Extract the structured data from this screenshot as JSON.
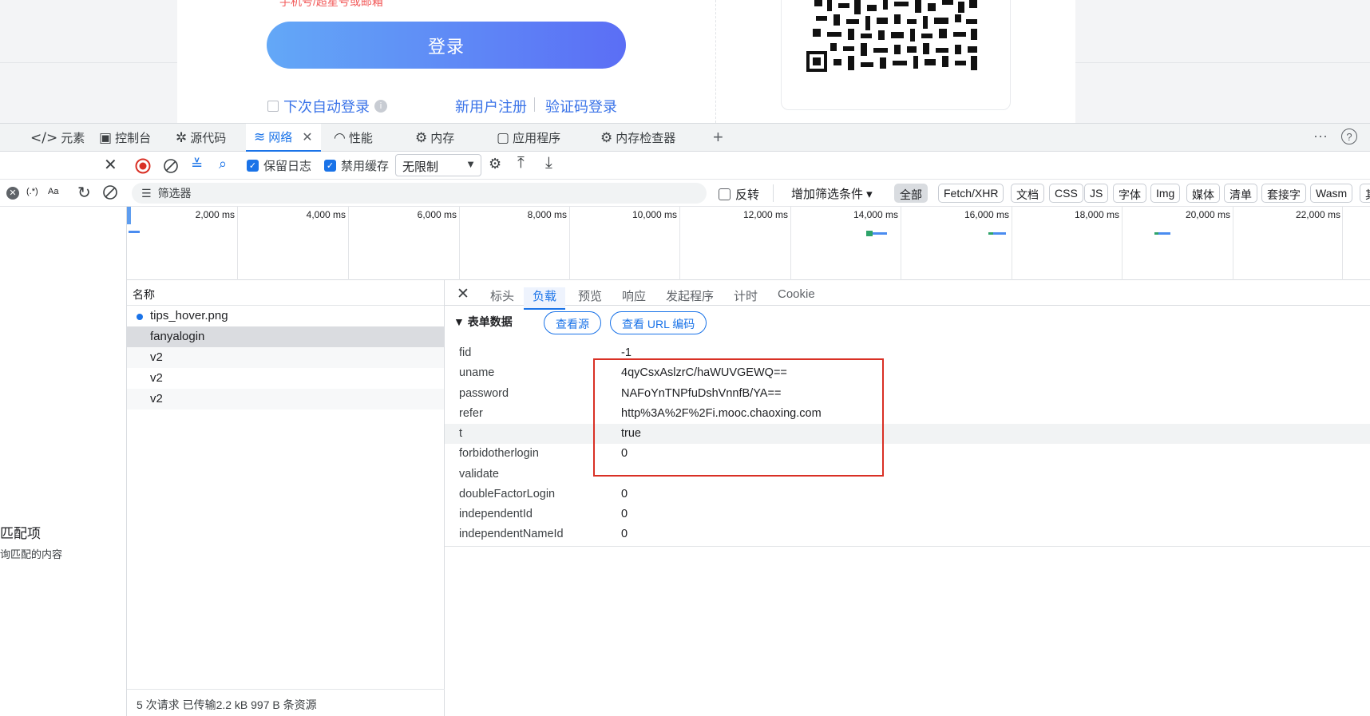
{
  "page": {
    "login_button": "登录",
    "cut_text": "手机号/超星号或邮箱",
    "auto_login": "下次自动登录",
    "register": "新用户注册",
    "code_login": "验证码登录"
  },
  "devtools": {
    "tabs": [
      {
        "icon": "</>",
        "label": "元素"
      },
      {
        "icon": "▣",
        "label": "控制台"
      },
      {
        "icon": "✲",
        "label": "源代码"
      },
      {
        "icon": "≋",
        "label": "网络"
      },
      {
        "icon": "◠",
        "label": "性能"
      },
      {
        "icon": "⚙",
        "label": "内存"
      },
      {
        "icon": "▢",
        "label": "应用程序"
      },
      {
        "icon": "⚙",
        "label": "内存检查器"
      }
    ],
    "add_tab": "+",
    "more": "···",
    "help": "?"
  },
  "toolbar": {
    "preserve_log": "保留日志",
    "disable_cache": "禁用缓存",
    "throttle": "无限制"
  },
  "filterbar": {
    "search_regex": "(.*)",
    "search_case": "Aa",
    "filter_placeholder": "筛选器",
    "invert": "反转",
    "more_filters": "增加筛选条件 ▾",
    "chips": [
      "全部",
      "Fetch/XHR",
      "文档",
      "CSS",
      "JS",
      "字体",
      "Img",
      "媒体",
      "清单",
      "套接字",
      "Wasm",
      "其"
    ]
  },
  "search_pane": {
    "title": "匹配项",
    "hint": "询匹配的内容"
  },
  "overview": {
    "ticks": [
      "2,000 ms",
      "4,000 ms",
      "6,000 ms",
      "8,000 ms",
      "10,000 ms",
      "12,000 ms",
      "14,000 ms",
      "16,000 ms",
      "18,000 ms",
      "20,000 ms",
      "22,000 ms"
    ]
  },
  "requests": {
    "header": "名称",
    "rows": [
      "tips_hover.png",
      "fanyalogin",
      "v2",
      "v2",
      "v2"
    ],
    "footer": "5 次请求   已传输2.2 kB   997 B 条资源"
  },
  "detail": {
    "tabs": [
      "标头",
      "负载",
      "预览",
      "响应",
      "发起程序",
      "计时",
      "Cookie"
    ],
    "section": "表单数据",
    "view_source": "查看源",
    "view_url": "查看 URL 编码",
    "fields": [
      {
        "k": "fid",
        "v": "-1"
      },
      {
        "k": "uname",
        "v": "4qyCsxAslzrC/haWUVGEWQ=="
      },
      {
        "k": "password",
        "v": "NAFoYnTNPfuDshVnnfB/YA=="
      },
      {
        "k": "refer",
        "v": "http%3A%2F%2Fi.mooc.chaoxing.com"
      },
      {
        "k": "t",
        "v": "true"
      },
      {
        "k": "forbidotherlogin",
        "v": "0"
      },
      {
        "k": "validate",
        "v": ""
      },
      {
        "k": "doubleFactorLogin",
        "v": "0"
      },
      {
        "k": "independentId",
        "v": "0"
      },
      {
        "k": "independentNameId",
        "v": "0"
      }
    ]
  }
}
